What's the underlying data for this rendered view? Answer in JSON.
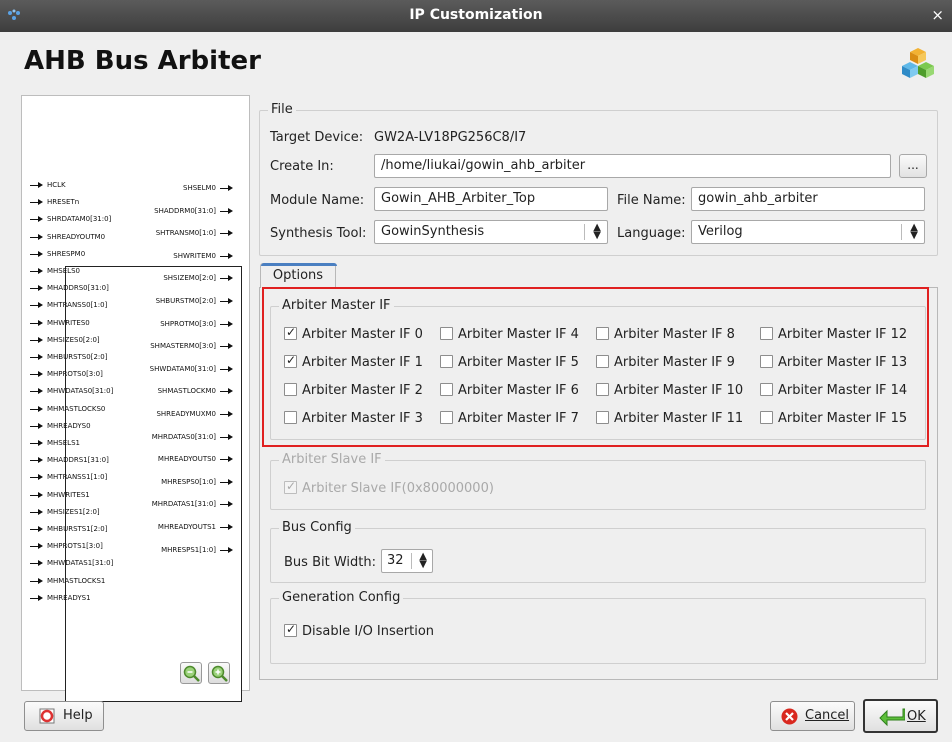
{
  "window": {
    "title": "IP Customization",
    "close_glyph": "×"
  },
  "header": {
    "title": "AHB Bus Arbiter",
    "logo_icon": "ip-cubes-icon"
  },
  "symbol": {
    "inputs": [
      "HCLK",
      "HRESETn",
      "SHRDATAM0[31:0]",
      "SHREADYOUTM0",
      "SHRESPM0",
      "MHSELS0",
      "MHADDRS0[31:0]",
      "MHTRANSS0[1:0]",
      "MHWRITES0",
      "MHSIZES0[2:0]",
      "MHBURSTS0[2:0]",
      "MHPROTS0[3:0]",
      "MHWDATAS0[31:0]",
      "MHMASTLOCKS0",
      "MHREADYS0",
      "MHSELS1",
      "MHADDRS1[31:0]",
      "MHTRANSS1[1:0]",
      "MHWRITES1",
      "MHSIZES1[2:0]",
      "MHBURSTS1[2:0]",
      "MHPROTS1[3:0]",
      "MHWDATAS1[31:0]",
      "MHMASTLOCKS1",
      "MHREADYS1"
    ],
    "outputs": [
      "SHSELM0",
      "SHADDRM0[31:0]",
      "SHTRANSM0[1:0]",
      "SHWRITEM0",
      "SHSIZEM0[2:0]",
      "SHBURSTM0[2:0]",
      "SHPROTM0[3:0]",
      "SHMASTERM0[3:0]",
      "SHWDATAM0[31:0]",
      "SHMASTLOCKM0",
      "SHREADYMUXM0",
      "MHRDATAS0[31:0]",
      "MHREADYOUTS0",
      "MHRESPS0[1:0]",
      "MHRDATAS1[31:0]",
      "MHREADYOUTS1",
      "MHRESPS1[1:0]"
    ]
  },
  "file": {
    "legend": "File",
    "target_device_label": "Target Device:",
    "target_device_value": "GW2A-LV18PG256C8/I7",
    "create_in_label": "Create In:",
    "create_in_value": "/home/liukai/gowin_ahb_arbiter",
    "browse_label": "...",
    "module_name_label": "Module Name:",
    "module_name_value": "Gowin_AHB_Arbiter_Top",
    "file_name_label": "File Name:",
    "file_name_value": "gowin_ahb_arbiter",
    "synthesis_tool_label": "Synthesis Tool:",
    "synthesis_tool_value": "GowinSynthesis",
    "language_label": "Language:",
    "language_value": "Verilog"
  },
  "options": {
    "tab_label": "Options",
    "master_if": {
      "legend": "Arbiter Master IF",
      "items": [
        {
          "label": "Arbiter Master IF 0",
          "checked": true
        },
        {
          "label": "Arbiter Master IF 1",
          "checked": true
        },
        {
          "label": "Arbiter Master IF 2",
          "checked": false
        },
        {
          "label": "Arbiter Master IF 3",
          "checked": false
        },
        {
          "label": "Arbiter Master IF 4",
          "checked": false
        },
        {
          "label": "Arbiter Master IF 5",
          "checked": false
        },
        {
          "label": "Arbiter Master IF 6",
          "checked": false
        },
        {
          "label": "Arbiter Master IF 7",
          "checked": false
        },
        {
          "label": "Arbiter Master IF 8",
          "checked": false
        },
        {
          "label": "Arbiter Master IF 9",
          "checked": false
        },
        {
          "label": "Arbiter Master IF 10",
          "checked": false
        },
        {
          "label": "Arbiter Master IF 11",
          "checked": false
        },
        {
          "label": "Arbiter Master IF 12",
          "checked": false
        },
        {
          "label": "Arbiter Master IF 13",
          "checked": false
        },
        {
          "label": "Arbiter Master IF 14",
          "checked": false
        },
        {
          "label": "Arbiter Master IF 15",
          "checked": false
        }
      ]
    },
    "slave_if": {
      "legend": "Arbiter Slave IF",
      "item_label": "Arbiter Slave IF(0x80000000)",
      "checked": true
    },
    "bus_config": {
      "legend": "Bus Config",
      "bus_bit_width_label": "Bus Bit Width:",
      "bus_bit_width_value": "32"
    },
    "generation_config": {
      "legend": "Generation Config",
      "disable_io_label": "Disable I/O Insertion",
      "checked": true
    }
  },
  "footer": {
    "help_label": "Help",
    "cancel_label": "Cancel",
    "ok_label": "OK"
  }
}
